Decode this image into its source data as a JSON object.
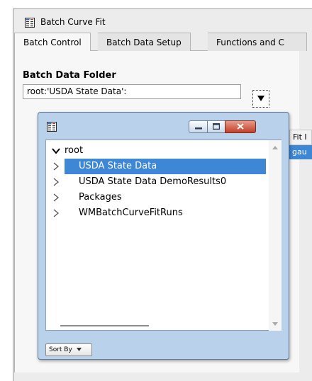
{
  "window": {
    "title": "Batch Curve Fit",
    "icon": "table-icon"
  },
  "tabs": [
    {
      "label": "Batch Control",
      "active": true
    },
    {
      "label": "Batch Data Setup",
      "active": false
    },
    {
      "label": "Functions and C",
      "active": false
    }
  ],
  "batch_data_folder": {
    "label": "Batch Data Folder",
    "value": "root:'USDA State Data':",
    "dropdown_icon": "triangle-down-icon"
  },
  "side_column": {
    "header": "Fit I",
    "selected_cell": "gau"
  },
  "popup": {
    "icon": "table-icon",
    "controls": [
      "minimize-icon",
      "maximize-icon",
      "close-icon"
    ],
    "tree": [
      {
        "label": "root",
        "expanded": true,
        "selected": false
      },
      {
        "label": "USDA State Data",
        "expanded": false,
        "selected": true
      },
      {
        "label": "USDA State Data DemoResults0",
        "expanded": false,
        "selected": false
      },
      {
        "label": "Packages",
        "expanded": false,
        "selected": false
      },
      {
        "label": "WMBatchCurveFitRuns",
        "expanded": false,
        "selected": false
      }
    ],
    "sort_by_label": "Sort By"
  }
}
